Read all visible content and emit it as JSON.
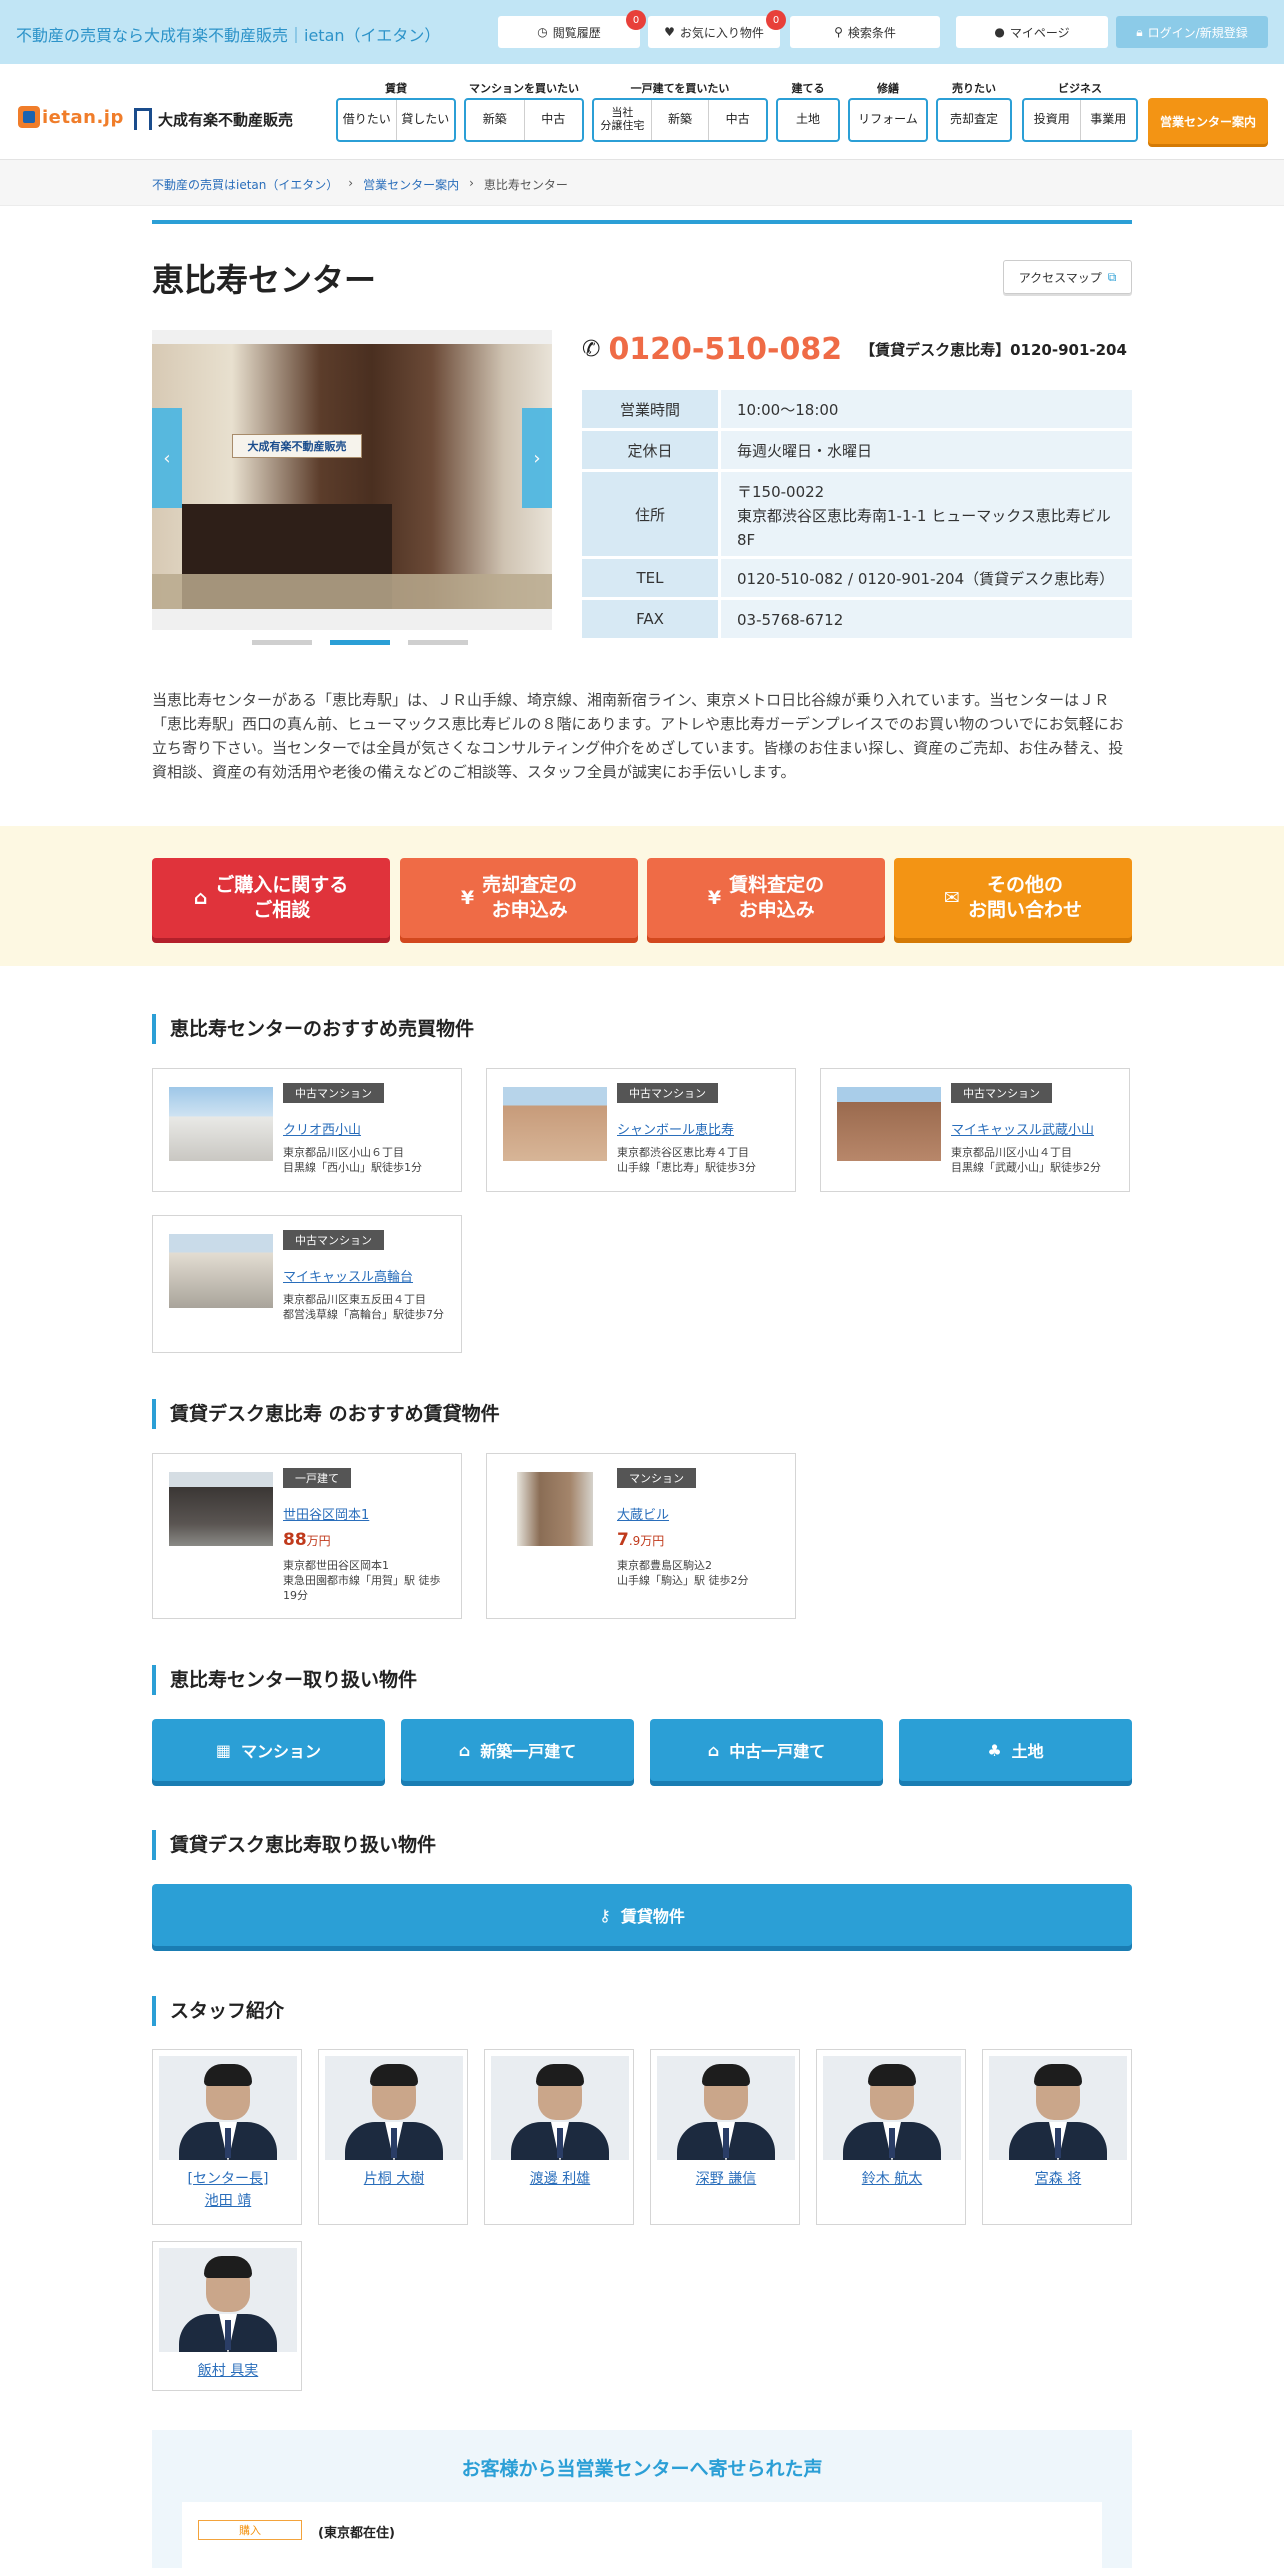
{
  "topbar": {
    "title": "不動産の売買なら大成有楽不動産販売｜ietan（イエタン）",
    "history": "閲覧履歴",
    "history_count": "0",
    "favorites": "お気に入り物件",
    "favorites_count": "0",
    "search": "検索条件",
    "mypage": "マイページ",
    "login": "ログイン/新規登録"
  },
  "header": {
    "logo_ietan": "ietan.jp",
    "logo_taisei": "大成有楽不動産販売",
    "nav": [
      {
        "label": "賃貸",
        "items": [
          "借りたい",
          "貸したい"
        ]
      },
      {
        "label": "マンションを買いたい",
        "items": [
          "新築",
          "中古"
        ]
      },
      {
        "label": "一戸建てを買いたい",
        "items": [
          "当社\n分譲住宅",
          "新築",
          "中古"
        ]
      },
      {
        "label": "建てる",
        "items": [
          "土地"
        ]
      },
      {
        "label": "修繕",
        "items": [
          "リフォーム"
        ]
      },
      {
        "label": "売りたい",
        "items": [
          "売却査定"
        ]
      },
      {
        "label": "ビジネス",
        "items": [
          "投資用",
          "事業用"
        ]
      }
    ],
    "cta": "営業センター案内"
  },
  "breadcrumb": [
    "不動産の売買はietan（イエタン）",
    "営業センター案内",
    "恵比寿センター"
  ],
  "page": {
    "title": "恵比寿センター",
    "access_map": "アクセスマップ",
    "tel_main": "0120-510-082",
    "tel_sub": "【賃貸デスク恵比寿】0120-901-204",
    "photo_sign": "大成有楽不動産販売"
  },
  "info": [
    {
      "k": "営業時間",
      "v": "10:00～18:00"
    },
    {
      "k": "定休日",
      "v": "毎週火曜日・水曜日"
    },
    {
      "k": "住所",
      "v": "〒150-0022\n東京都渋谷区恵比寿南1-1-1 ヒューマックス恵比寿ビル 8F"
    },
    {
      "k": "TEL",
      "v": "0120-510-082 / 0120-901-204（賃貸デスク恵比寿）"
    },
    {
      "k": "FAX",
      "v": "03-5768-6712"
    }
  ],
  "description": "当恵比寿センターがある「恵比寿駅」は、ＪＲ山手線、埼京線、湘南新宿ライン、東京メトロ日比谷線が乗り入れています。当センターはＪＲ「恵比寿駅」西口の真ん前、ヒューマックス恵比寿ビルの８階にあります。アトレや恵比寿ガーデンプレイスでのお買い物のついでにお気軽にお立ち寄り下さい。当センターでは全員が気さくなコンサルティング仲介をめざしています。皆様のお住まい探し、資産のご売却、お住み替え、投資相談、資産の有効活用や老後の備えなどのご相談等、スタッフ全員が誠実にお手伝いします。",
  "cta": [
    {
      "label": "ご購入に関する\nご相談",
      "color": "#e0333b",
      "shadow": "#b3202a",
      "icon": "house-icon"
    },
    {
      "label": "売却査定の\nお申込み",
      "color": "#ef6b46",
      "shadow": "#d2481e",
      "icon": "yen-icon"
    },
    {
      "label": "賃料査定の\nお申込み",
      "color": "#ef6b46",
      "shadow": "#d2481e",
      "icon": "yen-icon"
    },
    {
      "label": "その他の\nお問い合わせ",
      "color": "#f39414",
      "shadow": "#d47a05",
      "icon": "mail-icon"
    }
  ],
  "sale_section": {
    "heading": "恵比寿センターのおすすめ売買物件",
    "items": [
      {
        "tag": "中古マンション",
        "name": "クリオ西小山",
        "addr": "東京都品川区小山６丁目",
        "access": "目黒線「西小山」駅徒歩1分"
      },
      {
        "tag": "中古マンション",
        "name": "シャンボール恵比寿",
        "addr": "東京都渋谷区恵比寿４丁目",
        "access": "山手線「恵比寿」駅徒歩3分"
      },
      {
        "tag": "中古マンション",
        "name": "マイキャッスル武蔵小山",
        "addr": "東京都品川区小山４丁目",
        "access": "目黒線「武蔵小山」駅徒歩2分"
      },
      {
        "tag": "中古マンション",
        "name": "マイキャッスル高輪台",
        "addr": "東京都品川区東五反田４丁目",
        "access": "都営浅草線「高輪台」駅徒歩7分"
      }
    ]
  },
  "rent_section": {
    "heading": "賃貸デスク恵比寿 のおすすめ賃貸物件",
    "items": [
      {
        "tag": "一戸建て",
        "name": "世田谷区岡本1",
        "price_big": "88",
        "price_unit": "万円",
        "addr": "東京都世田谷区岡本1",
        "access": "東急田園都市線「用賀」駅 徒歩19分"
      },
      {
        "tag": "マンション",
        "name": "大蔵ビル",
        "price_big": "7",
        "price_unit": ".9万円",
        "addr": "東京都豊島区駒込2",
        "access": "山手線「駒込」駅 徒歩2分"
      }
    ]
  },
  "handled_section": {
    "heading": "恵比寿センター取り扱い物件",
    "buttons": [
      "マンション",
      "新築一戸建て",
      "中古一戸建て",
      "土地"
    ]
  },
  "rent_handled_section": {
    "heading": "賃貸デスク恵比寿取り扱い物件",
    "button": "賃貸物件"
  },
  "staff_section": {
    "heading": "スタッフ紹介",
    "staff": [
      {
        "line1": "[センター長]",
        "line2": "池田 靖"
      },
      {
        "line1": "片桐 大樹",
        "line2": ""
      },
      {
        "line1": "渡邊 利雄",
        "line2": ""
      },
      {
        "line1": "深野 謙信",
        "line2": ""
      },
      {
        "line1": "鈴木 航太",
        "line2": ""
      },
      {
        "line1": "宮森 将",
        "line2": ""
      },
      {
        "line1": "飯村 具実",
        "line2": ""
      }
    ]
  },
  "voice": {
    "heading": "お客様から当営業センターへ寄せられた声",
    "tag": "購入",
    "who": "(東京都在住)"
  }
}
